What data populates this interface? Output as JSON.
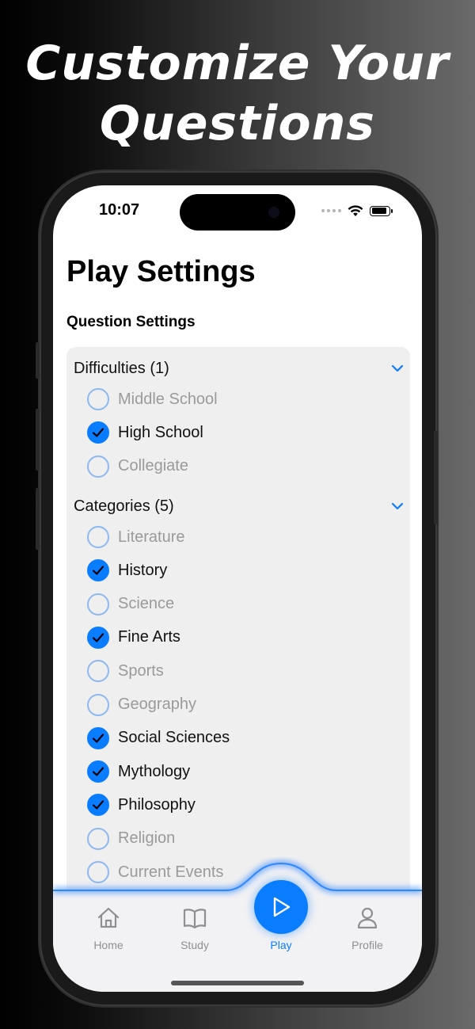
{
  "promo": {
    "headline_line1": "Customize Your",
    "headline_line2": "Questions"
  },
  "status_bar": {
    "time": "10:07"
  },
  "page": {
    "title": "Play Settings",
    "section_title": "Question Settings"
  },
  "difficulties": {
    "header": "Difficulties (1)",
    "items": [
      {
        "label": "Middle School",
        "checked": false
      },
      {
        "label": "High School",
        "checked": true
      },
      {
        "label": "Collegiate",
        "checked": false
      }
    ]
  },
  "categories": {
    "header": "Categories (5)",
    "items": [
      {
        "label": "Literature",
        "checked": false
      },
      {
        "label": "History",
        "checked": true
      },
      {
        "label": "Science",
        "checked": false
      },
      {
        "label": "Fine Arts",
        "checked": true
      },
      {
        "label": "Sports",
        "checked": false
      },
      {
        "label": "Geography",
        "checked": false
      },
      {
        "label": "Social Sciences",
        "checked": true
      },
      {
        "label": "Mythology",
        "checked": true
      },
      {
        "label": "Philosophy",
        "checked": true
      },
      {
        "label": "Religion",
        "checked": false
      },
      {
        "label": "Current Events",
        "checked": false
      }
    ]
  },
  "tabbar": {
    "tabs": [
      {
        "label": "Home",
        "icon": "house-icon",
        "active": false
      },
      {
        "label": "Study",
        "icon": "book-icon",
        "active": false
      },
      {
        "label": "Play",
        "icon": "play-icon",
        "active": true
      },
      {
        "label": "Profile",
        "icon": "person-icon",
        "active": false
      }
    ]
  },
  "colors": {
    "accent": "#0a7cff",
    "inactive_tab": "#8e8e93",
    "card_bg": "#efeff0"
  }
}
